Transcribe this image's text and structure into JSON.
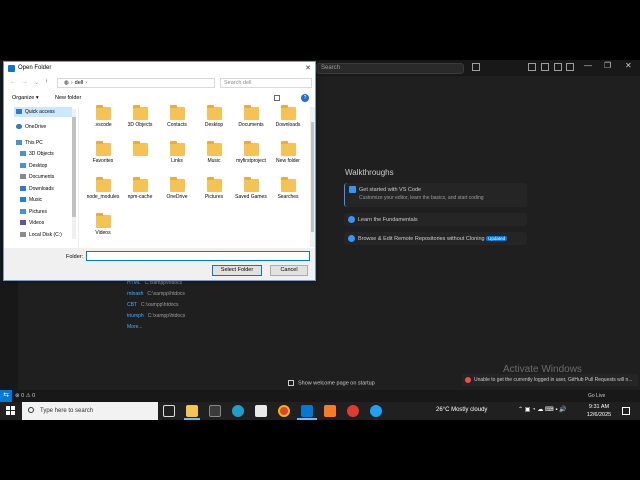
{
  "vscode": {
    "search_placeholder": "Search",
    "walkthroughs_title": "Walkthroughs",
    "walkthroughs": [
      {
        "title": "Get started with VS Code",
        "subtitle": "Customize your editor, learn the basics, and start coding",
        "badge": ""
      },
      {
        "title": "Learn the Fundamentals",
        "subtitle": "",
        "badge": ""
      },
      {
        "title": "Browse & Edit Remote Repositories without Cloning",
        "subtitle": "",
        "badge": "Updated"
      }
    ],
    "recent": [
      {
        "name": "HTML",
        "path": "C:\\xampp\\htdocs"
      },
      {
        "name": "rnlnash",
        "path": "C:\\xampp\\htdocs"
      },
      {
        "name": "CBT",
        "path": "C:\\xampp\\htdocs"
      },
      {
        "name": "triumph",
        "path": "C:\\xampp\\htdocs"
      }
    ],
    "recent_more": "More...",
    "startup_label": "Show welcome page on startup",
    "activate_windows": "Activate Windows",
    "notification": "Unable to get the currently logged in user, GitHub Pull Requests will n...",
    "status_problems": "⊗ 0 ⚠ 0",
    "go_live": "Go Live"
  },
  "dialog": {
    "title": "Open Folder",
    "address": [
      "dell"
    ],
    "search_placeholder": "Search dell",
    "organize": "Organize ▾",
    "new_folder": "New folder",
    "tree": [
      {
        "label": "Quick access",
        "icon": "star-icon",
        "color": "#2b7cd3"
      },
      {
        "label": "OneDrive",
        "icon": "cloud-icon",
        "color": "#2b7cd3"
      },
      {
        "label": "This PC",
        "icon": "pc-icon",
        "color": "#4a90d9"
      },
      {
        "label": "3D Objects",
        "icon": "cube-icon",
        "color": "#4a90d9"
      },
      {
        "label": "Desktop",
        "icon": "desktop-icon",
        "color": "#4a90d9"
      },
      {
        "label": "Documents",
        "icon": "documents-icon",
        "color": "#8a8a8a"
      },
      {
        "label": "Downloads",
        "icon": "downloads-icon",
        "color": "#2b7cd3"
      },
      {
        "label": "Music",
        "icon": "music-icon",
        "color": "#2b7cd3"
      },
      {
        "label": "Pictures",
        "icon": "pictures-icon",
        "color": "#4a90d9"
      },
      {
        "label": "Videos",
        "icon": "videos-icon",
        "color": "#6a4fa0"
      },
      {
        "label": "Local Disk (C:)",
        "icon": "disk-icon",
        "color": "#8a8a8a"
      }
    ],
    "files": [
      ".vscode",
      "3D Objects",
      "Contacts",
      "Desktop",
      "Documents",
      "Downloads",
      "Favorites",
      "",
      "Links",
      "Music",
      "myfirstproject",
      "New folder",
      "node_modules",
      "npm-cache",
      "OneDrive",
      "Pictures",
      "Saved Games",
      "Searches",
      "Videos"
    ],
    "folder_label": "Folder:",
    "folder_value": "",
    "select_button": "Select Folder",
    "cancel_button": "Cancel"
  },
  "taskbar": {
    "search_placeholder": "Type here to search",
    "weather": "26°C  Mostly cloudy",
    "time": "9:31 AM",
    "date": "12/6/2025"
  }
}
